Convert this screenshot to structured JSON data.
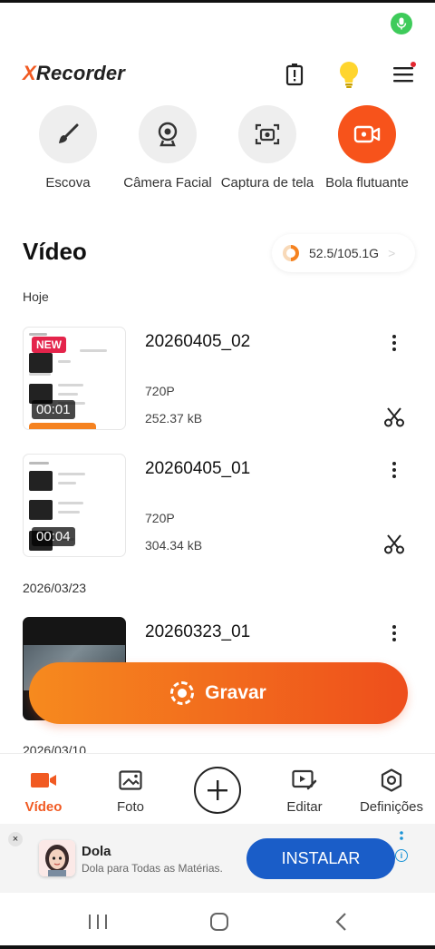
{
  "app": {
    "logo_x": "X",
    "logo_rest": "Recorder"
  },
  "tools": [
    {
      "label": "Escova",
      "icon": "brush-icon"
    },
    {
      "label": "Câmera Facial",
      "icon": "webcam-icon"
    },
    {
      "label": "Captura de tela",
      "icon": "screenshot-icon"
    },
    {
      "label": "Bola flutuante",
      "icon": "floating-ball-icon"
    }
  ],
  "section": {
    "title": "Vídeo",
    "storage": "52.5/105.1G",
    "storage_used_fraction": 0.5
  },
  "groups": [
    {
      "date": "Hoje"
    },
    {
      "date": "2026/03/23"
    },
    {
      "date": "2026/03/10"
    }
  ],
  "videos": [
    {
      "name": "20260405_02",
      "resolution": "720P",
      "size": "252.37 kB",
      "duration": "00:01",
      "badge": "NEW"
    },
    {
      "name": "20260405_01",
      "resolution": "720P",
      "size": "304.34 kB",
      "duration": "00:04"
    },
    {
      "name": "20260323_01"
    }
  ],
  "record": {
    "label": "Gravar"
  },
  "nav": [
    {
      "label": "Vídeo",
      "icon": "video-camera-icon",
      "active": true
    },
    {
      "label": "Foto",
      "icon": "photo-icon"
    },
    {
      "label": "Editar",
      "icon": "edit-video-icon"
    },
    {
      "label": "Definições",
      "icon": "settings-hexagon-icon"
    }
  ],
  "ad": {
    "close": "×",
    "title": "Dola",
    "subtitle": "Dola para Todas as Matérias.",
    "cta": "INSTALAR",
    "info": "i"
  },
  "colors": {
    "brand": "#f15a22",
    "record_gradient_start": "#f68a1e",
    "record_gradient_end": "#ee4e1c",
    "ad_button": "#1a5dc8"
  }
}
